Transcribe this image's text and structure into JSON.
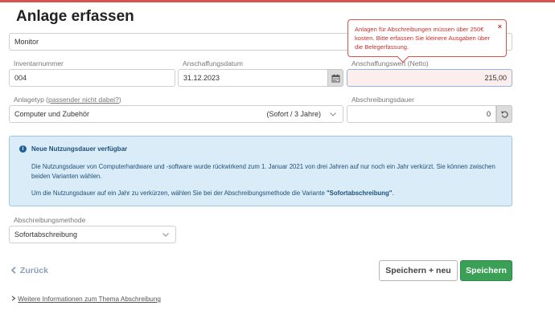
{
  "page": {
    "title": "Anlage erfassen"
  },
  "description": {
    "value": "Monitor"
  },
  "inventory": {
    "label": "Inventarnummer",
    "value": "004"
  },
  "acquisition_date": {
    "label": "Anschaffungsdatum",
    "value": "31.12.2023"
  },
  "acquisition_value": {
    "label": "Anschaffungswert (Netto)",
    "value": "215,00"
  },
  "error_popover": {
    "text": "Anlagen für Abschreibungen müssen über 250€ kosten. Bitte erfassen Sie kleinere Ausgaben über die Belegerfassung.",
    "close": "×"
  },
  "asset_type": {
    "label": "Anlagetyp",
    "link": "passender nicht dabei?",
    "value": "Computer und Zubehör",
    "hint": "(Sofort / 3 Jahre)"
  },
  "depreciation_period": {
    "label": "Abschreibungsdauer",
    "value": "0"
  },
  "info_box": {
    "title": "Neue Nutzungsdauer verfügbar",
    "paragraph1": "Die Nutzungsdauer von Computerhardware und -software wurde rückwirkend zum 1. Januar 2021 von drei Jahren auf nur noch ein Jahr verkürzt. Sie können zwischen beiden Varianten wählen.",
    "paragraph2_prefix": "Um die Nutzungsdauer auf ein Jahr zu verkürzen, wählen Sie bei der Abschreibungsmethode die Variante ",
    "paragraph2_bold": "\"Sofortabschreibung\"",
    "paragraph2_suffix": "."
  },
  "depreciation_method": {
    "label": "Abschreibungsmethode",
    "value": "Sofortabschreibung"
  },
  "actions": {
    "back": "Zurück",
    "save_new": "Speichern + neu",
    "save": "Speichern"
  },
  "footer": {
    "link": "Weitere Informationen zum Thema Abschreibung"
  },
  "colors": {
    "error": "#d9534f",
    "primary": "#3aa056",
    "info_bg": "#d9ecf7"
  }
}
